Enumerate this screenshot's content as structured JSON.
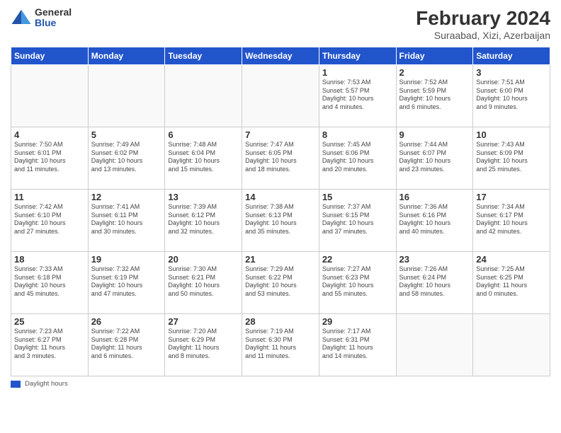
{
  "header": {
    "title": "February 2024",
    "subtitle": "Suraabad, Xizi, Azerbaijan",
    "logo_general": "General",
    "logo_blue": "Blue"
  },
  "columns": [
    "Sunday",
    "Monday",
    "Tuesday",
    "Wednesday",
    "Thursday",
    "Friday",
    "Saturday"
  ],
  "footer": {
    "legend_label": "Daylight hours"
  },
  "weeks": [
    [
      {
        "num": "",
        "info": ""
      },
      {
        "num": "",
        "info": ""
      },
      {
        "num": "",
        "info": ""
      },
      {
        "num": "",
        "info": ""
      },
      {
        "num": "1",
        "info": "Sunrise: 7:53 AM\nSunset: 5:57 PM\nDaylight: 10 hours\nand 4 minutes."
      },
      {
        "num": "2",
        "info": "Sunrise: 7:52 AM\nSunset: 5:59 PM\nDaylight: 10 hours\nand 6 minutes."
      },
      {
        "num": "3",
        "info": "Sunrise: 7:51 AM\nSunset: 6:00 PM\nDaylight: 10 hours\nand 9 minutes."
      }
    ],
    [
      {
        "num": "4",
        "info": "Sunrise: 7:50 AM\nSunset: 6:01 PM\nDaylight: 10 hours\nand 11 minutes."
      },
      {
        "num": "5",
        "info": "Sunrise: 7:49 AM\nSunset: 6:02 PM\nDaylight: 10 hours\nand 13 minutes."
      },
      {
        "num": "6",
        "info": "Sunrise: 7:48 AM\nSunset: 6:04 PM\nDaylight: 10 hours\nand 15 minutes."
      },
      {
        "num": "7",
        "info": "Sunrise: 7:47 AM\nSunset: 6:05 PM\nDaylight: 10 hours\nand 18 minutes."
      },
      {
        "num": "8",
        "info": "Sunrise: 7:45 AM\nSunset: 6:06 PM\nDaylight: 10 hours\nand 20 minutes."
      },
      {
        "num": "9",
        "info": "Sunrise: 7:44 AM\nSunset: 6:07 PM\nDaylight: 10 hours\nand 23 minutes."
      },
      {
        "num": "10",
        "info": "Sunrise: 7:43 AM\nSunset: 6:09 PM\nDaylight: 10 hours\nand 25 minutes."
      }
    ],
    [
      {
        "num": "11",
        "info": "Sunrise: 7:42 AM\nSunset: 6:10 PM\nDaylight: 10 hours\nand 27 minutes."
      },
      {
        "num": "12",
        "info": "Sunrise: 7:41 AM\nSunset: 6:11 PM\nDaylight: 10 hours\nand 30 minutes."
      },
      {
        "num": "13",
        "info": "Sunrise: 7:39 AM\nSunset: 6:12 PM\nDaylight: 10 hours\nand 32 minutes."
      },
      {
        "num": "14",
        "info": "Sunrise: 7:38 AM\nSunset: 6:13 PM\nDaylight: 10 hours\nand 35 minutes."
      },
      {
        "num": "15",
        "info": "Sunrise: 7:37 AM\nSunset: 6:15 PM\nDaylight: 10 hours\nand 37 minutes."
      },
      {
        "num": "16",
        "info": "Sunrise: 7:36 AM\nSunset: 6:16 PM\nDaylight: 10 hours\nand 40 minutes."
      },
      {
        "num": "17",
        "info": "Sunrise: 7:34 AM\nSunset: 6:17 PM\nDaylight: 10 hours\nand 42 minutes."
      }
    ],
    [
      {
        "num": "18",
        "info": "Sunrise: 7:33 AM\nSunset: 6:18 PM\nDaylight: 10 hours\nand 45 minutes."
      },
      {
        "num": "19",
        "info": "Sunrise: 7:32 AM\nSunset: 6:19 PM\nDaylight: 10 hours\nand 47 minutes."
      },
      {
        "num": "20",
        "info": "Sunrise: 7:30 AM\nSunset: 6:21 PM\nDaylight: 10 hours\nand 50 minutes."
      },
      {
        "num": "21",
        "info": "Sunrise: 7:29 AM\nSunset: 6:22 PM\nDaylight: 10 hours\nand 53 minutes."
      },
      {
        "num": "22",
        "info": "Sunrise: 7:27 AM\nSunset: 6:23 PM\nDaylight: 10 hours\nand 55 minutes."
      },
      {
        "num": "23",
        "info": "Sunrise: 7:26 AM\nSunset: 6:24 PM\nDaylight: 10 hours\nand 58 minutes."
      },
      {
        "num": "24",
        "info": "Sunrise: 7:25 AM\nSunset: 6:25 PM\nDaylight: 11 hours\nand 0 minutes."
      }
    ],
    [
      {
        "num": "25",
        "info": "Sunrise: 7:23 AM\nSunset: 6:27 PM\nDaylight: 11 hours\nand 3 minutes."
      },
      {
        "num": "26",
        "info": "Sunrise: 7:22 AM\nSunset: 6:28 PM\nDaylight: 11 hours\nand 6 minutes."
      },
      {
        "num": "27",
        "info": "Sunrise: 7:20 AM\nSunset: 6:29 PM\nDaylight: 11 hours\nand 8 minutes."
      },
      {
        "num": "28",
        "info": "Sunrise: 7:19 AM\nSunset: 6:30 PM\nDaylight: 11 hours\nand 11 minutes."
      },
      {
        "num": "29",
        "info": "Sunrise: 7:17 AM\nSunset: 6:31 PM\nDaylight: 11 hours\nand 14 minutes."
      },
      {
        "num": "",
        "info": ""
      },
      {
        "num": "",
        "info": ""
      }
    ]
  ]
}
